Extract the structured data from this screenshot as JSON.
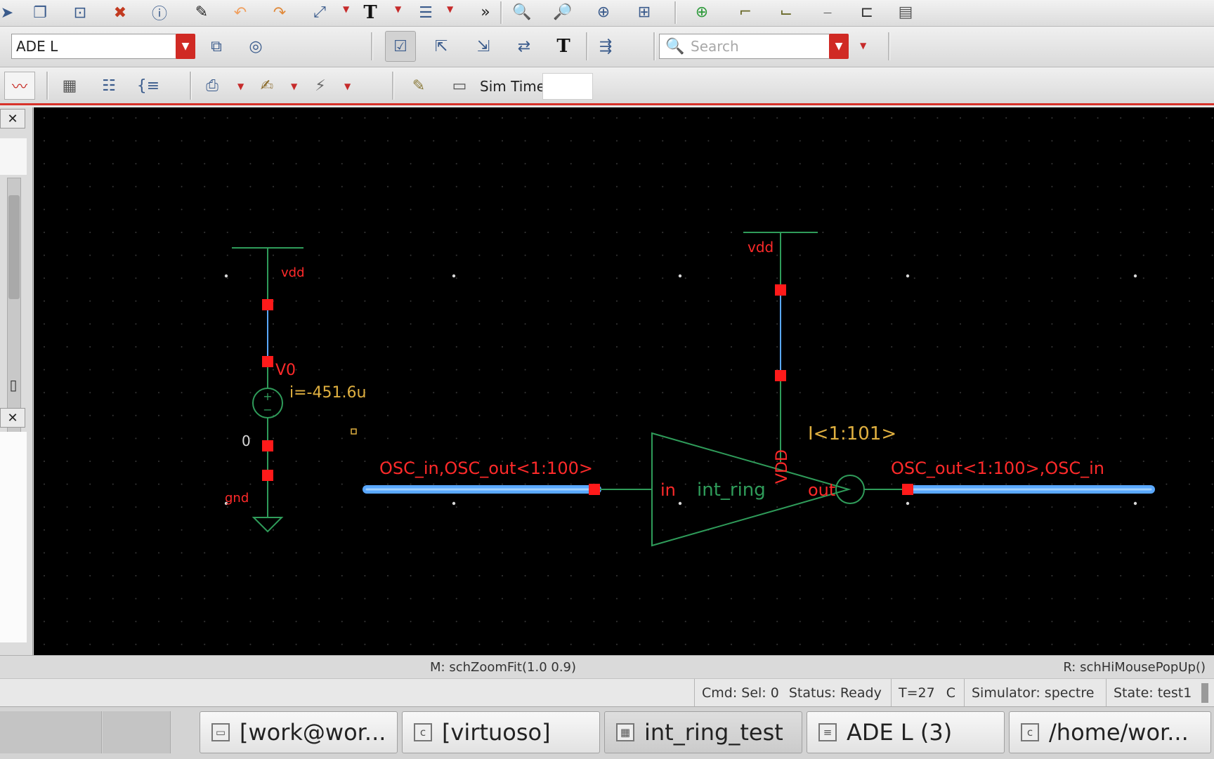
{
  "toolbar2": {
    "workspace_value": "ADE L",
    "search_placeholder": "Search"
  },
  "toolbar3": {
    "simtime_label": "Sim Time"
  },
  "schematic": {
    "vsrc_vdd": "vdd",
    "vsrc_name": "V0",
    "vsrc_current": "i=-451.6u",
    "vsrc_node": "0",
    "vsrc_gnd": "gnd",
    "inst_vdd": "vdd",
    "inst_name": "int_ring",
    "inst_pin_in": "in",
    "inst_pin_out": "out",
    "inst_pin_vdd": "VDD",
    "inst_array": "I<1:101>",
    "wire_left_label": "OSC_in,OSC_out<1:100>",
    "wire_right_label": "OSC_out<1:100>,OSC_in",
    "colors": {
      "background": "#000000",
      "wire": "#2f9c5a",
      "pin": "#ff1a1a",
      "label": "#ff2a2a",
      "bus": "#5aa8ff",
      "annotation": "#e0b040"
    }
  },
  "message_bar": {
    "left": "M: schZoomFit(1.0 0.9)",
    "right": "R: schHiMousePopUp()"
  },
  "status_bar": {
    "cmd": "Cmd: Sel: 0",
    "status": "Status: Ready",
    "temp": "T=27",
    "temp_unit": "C",
    "simulator": "Simulator: spectre",
    "state": "State: test1"
  },
  "taskbar": {
    "tasks": [
      {
        "label": "[work@wor..."
      },
      {
        "label": "[virtuoso]"
      },
      {
        "label": "int_ring_test"
      },
      {
        "label": "ADE L (3)"
      },
      {
        "label": "/home/wor..."
      }
    ]
  }
}
